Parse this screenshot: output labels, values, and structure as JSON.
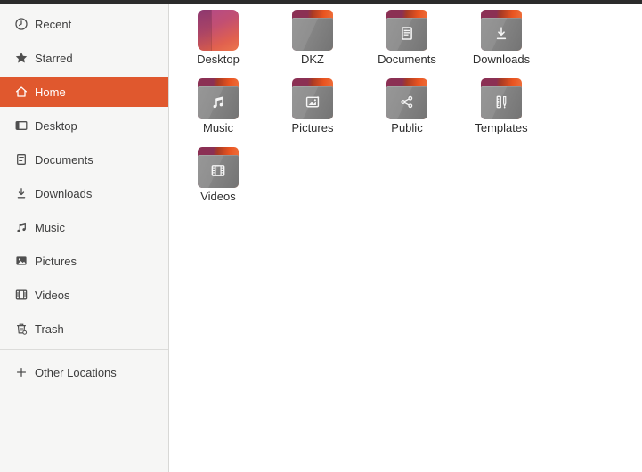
{
  "window": {
    "topbar_note": ""
  },
  "colors": {
    "accent": "#e0582e",
    "topbar": "#2b2b2b",
    "sidebar_bg": "#f6f6f5",
    "folder_gray": "#8a8a8a",
    "folder_orange": "#e95420",
    "folder_maroon": "#8b3054",
    "desktop_icon_purple": "#a4458d",
    "desktop_icon_orange": "#ec764c"
  },
  "sidebar": {
    "items": [
      {
        "label": "Recent",
        "icon": "clock-icon",
        "selected": false
      },
      {
        "label": "Starred",
        "icon": "star-icon",
        "selected": false
      },
      {
        "label": "Home",
        "icon": "home-icon",
        "selected": true
      },
      {
        "label": "Desktop",
        "icon": "desktop-icon",
        "selected": false
      },
      {
        "label": "Documents",
        "icon": "documents-icon",
        "selected": false
      },
      {
        "label": "Downloads",
        "icon": "downloads-icon",
        "selected": false
      },
      {
        "label": "Music",
        "icon": "music-icon",
        "selected": false
      },
      {
        "label": "Pictures",
        "icon": "pictures-icon",
        "selected": false
      },
      {
        "label": "Videos",
        "icon": "videos-icon",
        "selected": false
      },
      {
        "label": "Trash",
        "icon": "trash-icon",
        "selected": false
      }
    ],
    "other_locations": {
      "label": "Other Locations",
      "icon": "plus-icon"
    }
  },
  "files": {
    "items": [
      {
        "label": "Desktop",
        "icon": "user-desktop-icon"
      },
      {
        "label": "DKZ",
        "icon": "folder-icon"
      },
      {
        "label": "Documents",
        "icon": "folder-documents-icon"
      },
      {
        "label": "Downloads",
        "icon": "folder-downloads-icon"
      },
      {
        "label": "Music",
        "icon": "folder-music-icon"
      },
      {
        "label": "Pictures",
        "icon": "folder-pictures-icon"
      },
      {
        "label": "Public",
        "icon": "folder-public-icon"
      },
      {
        "label": "Templates",
        "icon": "folder-templates-icon"
      },
      {
        "label": "Videos",
        "icon": "folder-videos-icon"
      }
    ]
  }
}
